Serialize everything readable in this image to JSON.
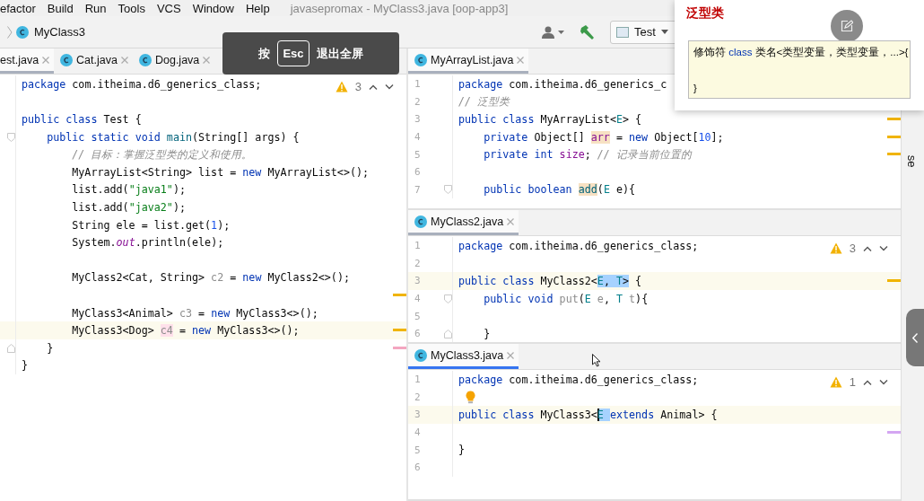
{
  "menu": [
    "efactor",
    "Build",
    "Run",
    "Tools",
    "VCS",
    "Window",
    "Help"
  ],
  "window": {
    "title": "javasepromax - MyClass3.java [oop-app3]"
  },
  "breadcrumb": {
    "label": "MyClass3"
  },
  "run_config": {
    "label": "Test"
  },
  "toast": {
    "before": "按",
    "key": "Esc",
    "after": "退出全屏"
  },
  "left_editor": {
    "tabs": [
      {
        "label": "est.java",
        "selected": true
      },
      {
        "label": "Cat.java",
        "selected": false
      },
      {
        "label": "Dog.java",
        "selected": false
      }
    ],
    "warnings": "3",
    "lines": [
      {
        "kind": "code",
        "tokens": [
          {
            "text": "package",
            "kind": "kw"
          },
          {
            "text": " com.itheima.d6_generics_class;",
            "kind": "plain"
          }
        ]
      },
      {
        "kind": "blank"
      },
      {
        "kind": "code",
        "tokens": [
          {
            "text": "public class",
            "kind": "kw"
          },
          {
            "text": " Test {",
            "kind": "plain"
          }
        ]
      },
      {
        "kind": "code",
        "fold_start": true,
        "tokens": [
          {
            "text": "    public static void ",
            "kind": "kw"
          },
          {
            "text": "main",
            "kind": "method"
          },
          {
            "text": "(String[] args) {",
            "kind": "plain"
          }
        ]
      },
      {
        "kind": "code",
        "tokens": [
          {
            "text": "        // 目标：掌握泛型类的定义和使用。",
            "kind": "comment"
          }
        ]
      },
      {
        "kind": "code",
        "tokens": [
          {
            "text": "        MyArrayList<String> list = ",
            "kind": "plain"
          },
          {
            "text": "new",
            "kind": "kw"
          },
          {
            "text": " MyArrayList<>();",
            "kind": "plain"
          }
        ]
      },
      {
        "kind": "code",
        "tokens": [
          {
            "text": "        list.add(",
            "kind": "plain"
          },
          {
            "text": "\"java1\"",
            "kind": "str"
          },
          {
            "text": ");",
            "kind": "plain"
          }
        ]
      },
      {
        "kind": "code",
        "tokens": [
          {
            "text": "        list.add(",
            "kind": "plain"
          },
          {
            "text": "\"java2\"",
            "kind": "str"
          },
          {
            "text": ");",
            "kind": "plain"
          }
        ]
      },
      {
        "kind": "code",
        "tokens": [
          {
            "text": "        String ele = list.get(",
            "kind": "plain"
          },
          {
            "text": "1",
            "kind": "num"
          },
          {
            "text": ");",
            "kind": "plain"
          }
        ]
      },
      {
        "kind": "code",
        "tokens": [
          {
            "text": "        System.",
            "kind": "plain"
          },
          {
            "text": "out",
            "kind": "static"
          },
          {
            "text": ".println(ele);",
            "kind": "plain"
          }
        ]
      },
      {
        "kind": "blank"
      },
      {
        "kind": "code",
        "tokens": [
          {
            "text": "        MyClass2<Cat, String> ",
            "kind": "plain"
          },
          {
            "text": "c2",
            "kind": "unused"
          },
          {
            "text": " = ",
            "kind": "plain"
          },
          {
            "text": "new",
            "kind": "kw"
          },
          {
            "text": " MyClass2<>();",
            "kind": "plain"
          }
        ]
      },
      {
        "kind": "blank",
        "stripe": {
          "color": "#f0b400"
        }
      },
      {
        "kind": "code",
        "tokens": [
          {
            "text": "        MyClass3<Animal> ",
            "kind": "plain"
          },
          {
            "text": "c3",
            "kind": "unused"
          },
          {
            "text": " = ",
            "kind": "plain"
          },
          {
            "text": "new",
            "kind": "kw"
          },
          {
            "text": " MyClass3<>();",
            "kind": "plain"
          }
        ]
      },
      {
        "kind": "code",
        "current": true,
        "stripe": {
          "color": "#f0b400"
        },
        "tokens": [
          {
            "text": "        MyClass3<Dog> ",
            "kind": "plain"
          },
          {
            "text": "c4",
            "kind": "unused",
            "error_highlight": true
          },
          {
            "text": " = ",
            "kind": "plain"
          },
          {
            "text": "new",
            "kind": "kw"
          },
          {
            "text": " MyClass3<>();",
            "kind": "plain"
          }
        ]
      },
      {
        "kind": "code",
        "fold_end": true,
        "stripe": {
          "color": "#f4a6c0"
        },
        "tokens": [
          {
            "text": "    }",
            "kind": "plain"
          }
        ]
      },
      {
        "kind": "code",
        "tokens": [
          {
            "text": "}",
            "kind": "plain"
          }
        ]
      }
    ]
  },
  "right_panes": [
    {
      "tab": {
        "label": "MyArrayList.java",
        "selected": true
      },
      "active": false,
      "lines": [
        {
          "kind": "code",
          "number": "1",
          "tokens": [
            {
              "text": "package",
              "kind": "kw"
            },
            {
              "text": " com.itheima.d6_generics_c",
              "kind": "plain"
            }
          ]
        },
        {
          "kind": "code",
          "number": "2",
          "tokens": [
            {
              "text": "// 泛型类",
              "kind": "comment"
            }
          ]
        },
        {
          "kind": "code",
          "number": "3",
          "stripe": {
            "color": "#f0b400"
          },
          "tokens": [
            {
              "text": "public class",
              "kind": "kw"
            },
            {
              "text": " MyArrayList<",
              "kind": "plain"
            },
            {
              "text": "E",
              "kind": "tparam"
            },
            {
              "text": "> {",
              "kind": "plain"
            }
          ]
        },
        {
          "kind": "code",
          "number": "4",
          "stripe": {
            "color": "#f0b400"
          },
          "tokens": [
            {
              "text": "    private",
              "kind": "kw"
            },
            {
              "text": " Object[] ",
              "kind": "plain"
            },
            {
              "text": "arr",
              "kind": "field",
              "usage_highlight": true
            },
            {
              "text": " = ",
              "kind": "plain"
            },
            {
              "text": "new",
              "kind": "kw"
            },
            {
              "text": " Object[",
              "kind": "plain"
            },
            {
              "text": "10",
              "kind": "num"
            },
            {
              "text": "];",
              "kind": "plain"
            }
          ]
        },
        {
          "kind": "code",
          "number": "5",
          "stripe": {
            "color": "#f0b400"
          },
          "tokens": [
            {
              "text": "    private int ",
              "kind": "kw"
            },
            {
              "text": "size",
              "kind": "field"
            },
            {
              "text": "; ",
              "kind": "plain"
            },
            {
              "text": "// 记录当前位置的",
              "kind": "comment"
            }
          ]
        },
        {
          "kind": "blank",
          "number": "6"
        },
        {
          "kind": "code",
          "number": "7",
          "fold_start": true,
          "tokens": [
            {
              "text": "    public boolean ",
              "kind": "kw"
            },
            {
              "text": "add",
              "kind": "method",
              "usage_highlight": true
            },
            {
              "text": "(",
              "kind": "plain"
            },
            {
              "text": "E",
              "kind": "tparam"
            },
            {
              "text": " e){",
              "kind": "plain"
            }
          ]
        }
      ]
    },
    {
      "tab": {
        "label": "MyClass2.java",
        "selected": true
      },
      "active": false,
      "warnings": "3",
      "lines": [
        {
          "kind": "code",
          "number": "1",
          "tokens": [
            {
              "text": "package",
              "kind": "kw"
            },
            {
              "text": " com.itheima.d6_generics_class;",
              "kind": "plain"
            }
          ]
        },
        {
          "kind": "blank",
          "number": "2"
        },
        {
          "kind": "code",
          "number": "3",
          "current": true,
          "stripe": {
            "color": "#f0b400"
          },
          "tokens": [
            {
              "text": "public class",
              "kind": "kw"
            },
            {
              "text": " MyClass2<",
              "kind": "plain"
            },
            {
              "text": "E",
              "kind": "tparam",
              "selection_highlight": true
            },
            {
              "text": ", ",
              "kind": "plain",
              "selection_highlight": true
            },
            {
              "text": "T",
              "kind": "tparam",
              "selection_highlight": true
            },
            {
              "text": ">",
              "kind": "plain",
              "selection_highlight": true
            },
            {
              "text": " {",
              "kind": "plain"
            }
          ]
        },
        {
          "kind": "code",
          "number": "4",
          "fold_start": true,
          "tokens": [
            {
              "text": "    public void ",
              "kind": "kw"
            },
            {
              "text": "put",
              "kind": "unused"
            },
            {
              "text": "(",
              "kind": "plain"
            },
            {
              "text": "E",
              "kind": "tparam"
            },
            {
              "text": " e",
              "kind": "unused"
            },
            {
              "text": ", ",
              "kind": "plain"
            },
            {
              "text": "T",
              "kind": "tparam"
            },
            {
              "text": " t",
              "kind": "unused"
            },
            {
              "text": "){",
              "kind": "plain"
            }
          ]
        },
        {
          "kind": "blank",
          "number": "5"
        },
        {
          "kind": "code",
          "number": "6",
          "fold_end": true,
          "tokens": [
            {
              "text": "    }",
              "kind": "plain"
            }
          ]
        }
      ]
    },
    {
      "tab": {
        "label": "MyClass3.java",
        "selected": true
      },
      "active": true,
      "warnings": "1",
      "lines": [
        {
          "kind": "code",
          "number": "1",
          "tokens": [
            {
              "text": "package",
              "kind": "kw"
            },
            {
              "text": " com.itheima.d6_generics_class;",
              "kind": "plain"
            }
          ]
        },
        {
          "kind": "blank",
          "number": "2",
          "intention": true
        },
        {
          "kind": "code",
          "number": "3",
          "current": true,
          "tokens": [
            {
              "text": "public class",
              "kind": "kw"
            },
            {
              "text": " MyClass3<",
              "kind": "plain"
            },
            {
              "text": "E ",
              "kind": "tparam",
              "selection_highlight": true,
              "caret": true
            },
            {
              "text": "extends",
              "kind": "kw"
            },
            {
              "text": " Animal> {",
              "kind": "plain"
            }
          ]
        },
        {
          "kind": "blank",
          "number": "4",
          "stripe": {
            "color": "#d4a6f2"
          }
        },
        {
          "kind": "code",
          "number": "5",
          "tokens": [
            {
              "text": "}",
              "kind": "plain"
            }
          ]
        },
        {
          "kind": "blank",
          "number": "6"
        }
      ]
    }
  ],
  "side_strip": {
    "label": "se"
  },
  "popup": {
    "title": "泛型类",
    "lines": [
      [
        {
          "text": "修饰符 ",
          "kind": "plain"
        },
        {
          "text": "class",
          "kind": "kw"
        },
        {
          "text": " 类名<类型变量，类型变量，...>{",
          "kind": "plain"
        }
      ],
      [
        {
          "text": "}",
          "kind": "plain"
        }
      ]
    ]
  }
}
